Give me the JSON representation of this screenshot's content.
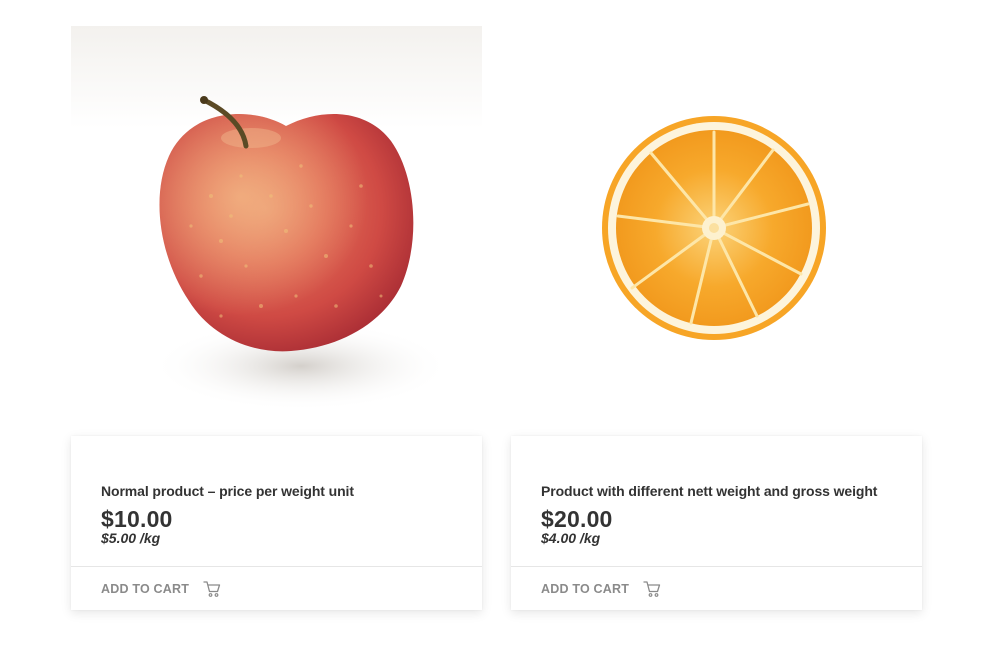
{
  "products": [
    {
      "title": "Normal product – price per weight unit",
      "price": "$10.00",
      "unit_price": "$5.00 /kg",
      "add_to_cart_label": "ADD TO CART",
      "image": "apple-image",
      "cart_icon": "cart-icon"
    },
    {
      "title": "Product with different nett weight and gross weight",
      "price": "$20.00",
      "unit_price": "$4.00 /kg",
      "add_to_cart_label": "ADD TO CART",
      "image": "orange-slice-image",
      "cart_icon": "cart-icon"
    }
  ],
  "colors": {
    "text": "#333333",
    "muted": "#8a8a8a",
    "divider": "#e6e6e6"
  }
}
